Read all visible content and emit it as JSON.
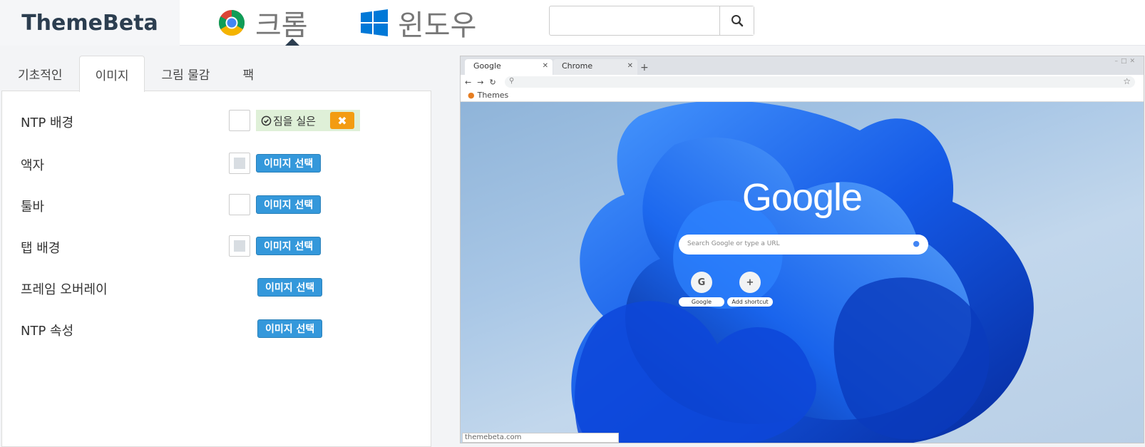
{
  "brand": "ThemeBeta",
  "nav": {
    "chrome_label": "크롬",
    "windows_label": "윈도우"
  },
  "search": {
    "placeholder": "",
    "value": ""
  },
  "tabs": [
    "기초적인",
    "이미지",
    "그림 물감",
    "팩"
  ],
  "active_tab": "이미지",
  "rows": {
    "ntp_background": {
      "label": "NTP 배경",
      "loaded_label": "짐을 실은",
      "remove": "✖"
    },
    "frame": {
      "label": "액자",
      "button": "이미지 선택"
    },
    "toolbar": {
      "label": "툴바",
      "button": "이미지 선택"
    },
    "tab_background": {
      "label": "탭 배경",
      "button": "이미지 선택"
    },
    "frame_overlay": {
      "label": "프레임 오버레이",
      "button": "이미지 선택"
    },
    "ntp_attribution": {
      "label": "NTP 속성",
      "button": "이미지 선택"
    }
  },
  "preview": {
    "tab1": "Google",
    "tab2": "Chrome",
    "bookmark": "Themes",
    "logo": "Google",
    "search_placeholder": "Search Google or type a URL",
    "shortcut1": "Google",
    "shortcut1_icon": "G",
    "shortcut2": "Add shortcut",
    "shortcut2_icon": "+",
    "status_url": "themebeta.com"
  },
  "colors": {
    "accent": "#3498db",
    "warning": "#f39c12",
    "success_bg": "#dff0d8",
    "brand_text": "#2c3e50"
  }
}
